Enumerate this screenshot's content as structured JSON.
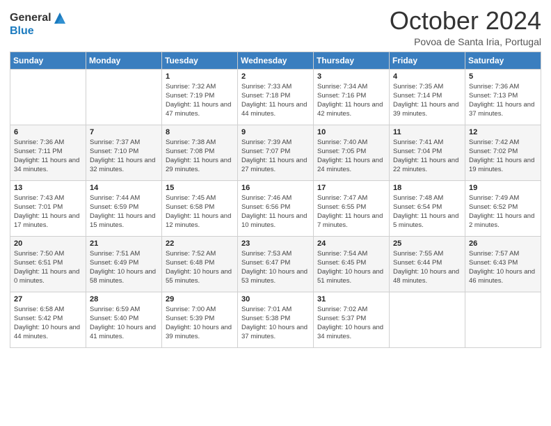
{
  "header": {
    "logo": {
      "general": "General",
      "blue": "Blue"
    },
    "title": "October 2024",
    "location": "Povoa de Santa Iria, Portugal"
  },
  "days_of_week": [
    "Sunday",
    "Monday",
    "Tuesday",
    "Wednesday",
    "Thursday",
    "Friday",
    "Saturday"
  ],
  "weeks": [
    [
      {
        "day": "",
        "info": ""
      },
      {
        "day": "",
        "info": ""
      },
      {
        "day": "1",
        "info": "Sunrise: 7:32 AM\nSunset: 7:19 PM\nDaylight: 11 hours and 47 minutes."
      },
      {
        "day": "2",
        "info": "Sunrise: 7:33 AM\nSunset: 7:18 PM\nDaylight: 11 hours and 44 minutes."
      },
      {
        "day": "3",
        "info": "Sunrise: 7:34 AM\nSunset: 7:16 PM\nDaylight: 11 hours and 42 minutes."
      },
      {
        "day": "4",
        "info": "Sunrise: 7:35 AM\nSunset: 7:14 PM\nDaylight: 11 hours and 39 minutes."
      },
      {
        "day": "5",
        "info": "Sunrise: 7:36 AM\nSunset: 7:13 PM\nDaylight: 11 hours and 37 minutes."
      }
    ],
    [
      {
        "day": "6",
        "info": "Sunrise: 7:36 AM\nSunset: 7:11 PM\nDaylight: 11 hours and 34 minutes."
      },
      {
        "day": "7",
        "info": "Sunrise: 7:37 AM\nSunset: 7:10 PM\nDaylight: 11 hours and 32 minutes."
      },
      {
        "day": "8",
        "info": "Sunrise: 7:38 AM\nSunset: 7:08 PM\nDaylight: 11 hours and 29 minutes."
      },
      {
        "day": "9",
        "info": "Sunrise: 7:39 AM\nSunset: 7:07 PM\nDaylight: 11 hours and 27 minutes."
      },
      {
        "day": "10",
        "info": "Sunrise: 7:40 AM\nSunset: 7:05 PM\nDaylight: 11 hours and 24 minutes."
      },
      {
        "day": "11",
        "info": "Sunrise: 7:41 AM\nSunset: 7:04 PM\nDaylight: 11 hours and 22 minutes."
      },
      {
        "day": "12",
        "info": "Sunrise: 7:42 AM\nSunset: 7:02 PM\nDaylight: 11 hours and 19 minutes."
      }
    ],
    [
      {
        "day": "13",
        "info": "Sunrise: 7:43 AM\nSunset: 7:01 PM\nDaylight: 11 hours and 17 minutes."
      },
      {
        "day": "14",
        "info": "Sunrise: 7:44 AM\nSunset: 6:59 PM\nDaylight: 11 hours and 15 minutes."
      },
      {
        "day": "15",
        "info": "Sunrise: 7:45 AM\nSunset: 6:58 PM\nDaylight: 11 hours and 12 minutes."
      },
      {
        "day": "16",
        "info": "Sunrise: 7:46 AM\nSunset: 6:56 PM\nDaylight: 11 hours and 10 minutes."
      },
      {
        "day": "17",
        "info": "Sunrise: 7:47 AM\nSunset: 6:55 PM\nDaylight: 11 hours and 7 minutes."
      },
      {
        "day": "18",
        "info": "Sunrise: 7:48 AM\nSunset: 6:54 PM\nDaylight: 11 hours and 5 minutes."
      },
      {
        "day": "19",
        "info": "Sunrise: 7:49 AM\nSunset: 6:52 PM\nDaylight: 11 hours and 2 minutes."
      }
    ],
    [
      {
        "day": "20",
        "info": "Sunrise: 7:50 AM\nSunset: 6:51 PM\nDaylight: 11 hours and 0 minutes."
      },
      {
        "day": "21",
        "info": "Sunrise: 7:51 AM\nSunset: 6:49 PM\nDaylight: 10 hours and 58 minutes."
      },
      {
        "day": "22",
        "info": "Sunrise: 7:52 AM\nSunset: 6:48 PM\nDaylight: 10 hours and 55 minutes."
      },
      {
        "day": "23",
        "info": "Sunrise: 7:53 AM\nSunset: 6:47 PM\nDaylight: 10 hours and 53 minutes."
      },
      {
        "day": "24",
        "info": "Sunrise: 7:54 AM\nSunset: 6:45 PM\nDaylight: 10 hours and 51 minutes."
      },
      {
        "day": "25",
        "info": "Sunrise: 7:55 AM\nSunset: 6:44 PM\nDaylight: 10 hours and 48 minutes."
      },
      {
        "day": "26",
        "info": "Sunrise: 7:57 AM\nSunset: 6:43 PM\nDaylight: 10 hours and 46 minutes."
      }
    ],
    [
      {
        "day": "27",
        "info": "Sunrise: 6:58 AM\nSunset: 5:42 PM\nDaylight: 10 hours and 44 minutes."
      },
      {
        "day": "28",
        "info": "Sunrise: 6:59 AM\nSunset: 5:40 PM\nDaylight: 10 hours and 41 minutes."
      },
      {
        "day": "29",
        "info": "Sunrise: 7:00 AM\nSunset: 5:39 PM\nDaylight: 10 hours and 39 minutes."
      },
      {
        "day": "30",
        "info": "Sunrise: 7:01 AM\nSunset: 5:38 PM\nDaylight: 10 hours and 37 minutes."
      },
      {
        "day": "31",
        "info": "Sunrise: 7:02 AM\nSunset: 5:37 PM\nDaylight: 10 hours and 34 minutes."
      },
      {
        "day": "",
        "info": ""
      },
      {
        "day": "",
        "info": ""
      }
    ]
  ]
}
